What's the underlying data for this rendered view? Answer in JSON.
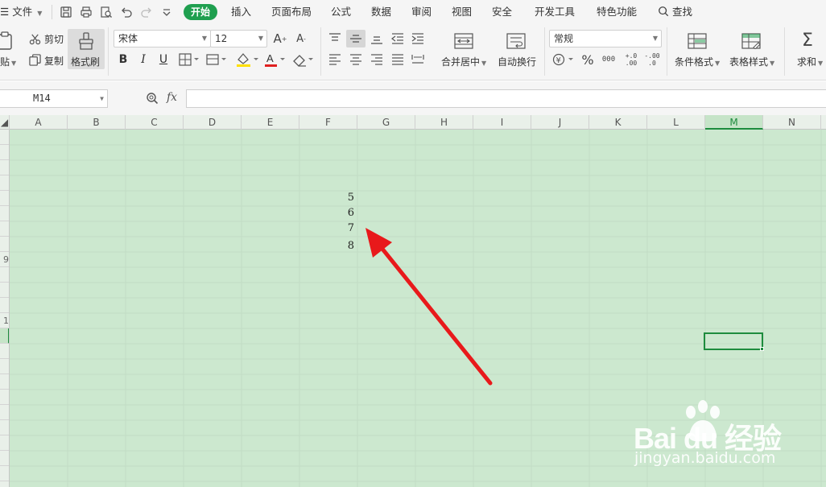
{
  "menu": {
    "hamburger": "☰",
    "file": "文件",
    "tabs": [
      "开始",
      "插入",
      "页面布局",
      "公式",
      "数据",
      "审阅",
      "视图",
      "安全",
      "开发工具",
      "特色功能"
    ],
    "search": "查找"
  },
  "ribbon": {
    "paste": "粘贴",
    "cut": "剪切",
    "copy": "复制",
    "format_painter": "格式刷",
    "font_name": "宋体",
    "font_size": "12",
    "merge_center": "合并居中",
    "wrap_text": "自动换行",
    "number_format": "常规",
    "conditional_format": "条件格式",
    "table_style": "表格样式",
    "sum": "求和",
    "percent": "%",
    "thousands": "000",
    "inc_decimal": "+.0 .00",
    "dec_decimal": "-.00 .0",
    "font_color": "#e02020",
    "highlight_color": "#ffe000"
  },
  "formula_bar": {
    "name_box": "M14",
    "fx": "fx",
    "formula": ""
  },
  "sheet": {
    "columns": [
      "A",
      "B",
      "C",
      "D",
      "E",
      "F",
      "G",
      "H",
      "I",
      "J",
      "K",
      "L",
      "M",
      "N"
    ],
    "active_column": "M",
    "row_labels": [
      "",
      "",
      "",
      "",
      "",
      "",
      "",
      "",
      "9",
      "",
      "",
      "",
      "1",
      "",
      "",
      "",
      "",
      "",
      "",
      "",
      "",
      "",
      "",
      ""
    ],
    "cells": [
      {
        "ref": "F5",
        "value": "5"
      },
      {
        "ref": "F6",
        "value": "6"
      },
      {
        "ref": "F7",
        "value": "7"
      },
      {
        "ref": "F8",
        "value": "8"
      }
    ],
    "grid_color": "#c2dcc4",
    "sheet_color": "#cce8cf",
    "accent": "#1e8c3e"
  },
  "annotation": {
    "arrow_color": "#e8191b"
  },
  "watermark": {
    "brand": "Bai du 经验",
    "url": "jingyan.baidu.com"
  }
}
